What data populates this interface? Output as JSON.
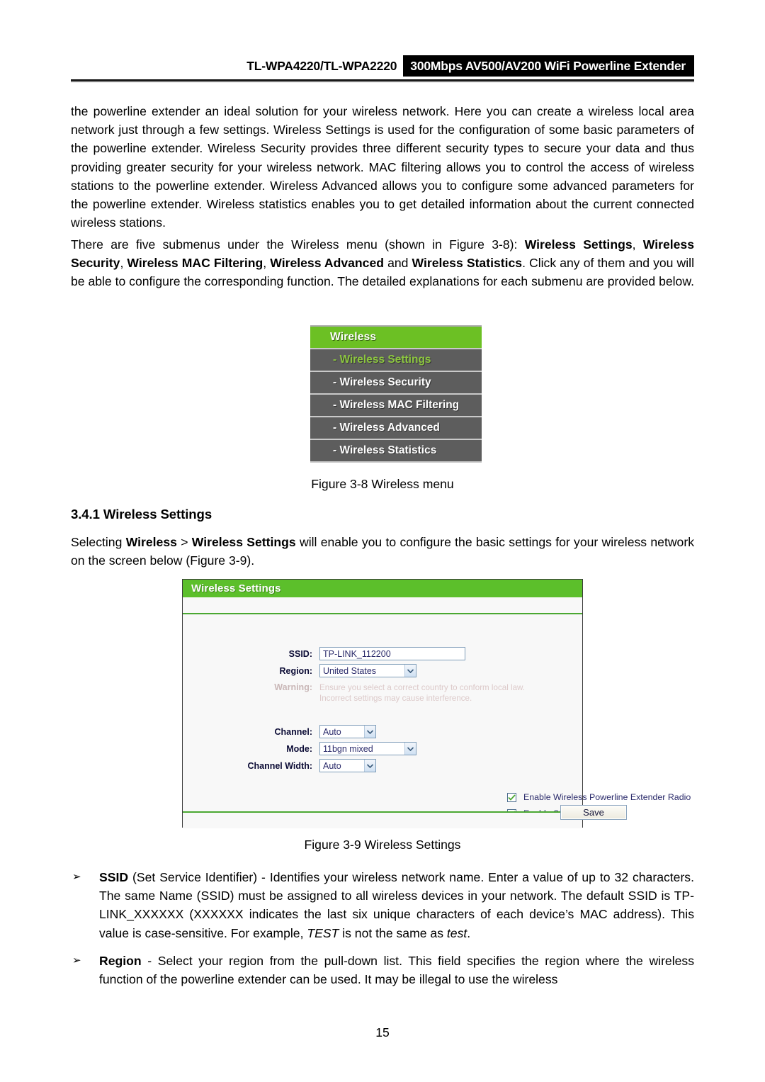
{
  "header": {
    "model": "TL-WPA4220/TL-WPA2220",
    "product": "300Mbps AV500/AV200 WiFi Powerline Extender"
  },
  "paragraphs": {
    "intro": "the powerline extender an ideal solution for your wireless network. Here you can create a wireless local area network just through a few settings. Wireless Settings is used for the configuration of some basic parameters of the powerline extender. Wireless Security provides three different security types to secure your data and thus providing greater security for your wireless network. MAC filtering allows you to control the access of wireless stations to the powerline extender. Wireless Advanced allows you to configure some advanced parameters for the powerline extender. Wireless statistics enables you to get detailed information about the current connected wireless stations.",
    "submenus_html": "There are five submenus under the Wireless menu (shown in Figure 3-8): <b>Wireless Settings</b>, <b>Wireless Security</b>, <b>Wireless MAC Filtering</b>, <b>Wireless Advanced</b> and <b>Wireless Statistics</b>. Click any of them and you will be able to configure the corresponding function. The detailed explanations for each submenu are provided below.",
    "selecting_html": "Selecting <b>Wireless</b> &gt; <b>Wireless Settings</b> will enable you to configure the basic settings for your wireless network on the screen below (Figure 3-9)."
  },
  "section_heading": "3.4.1 Wireless Settings",
  "figures": {
    "fig38_caption": "Figure 3-8 Wireless menu",
    "fig39_caption": "Figure 3-9 Wireless Settings"
  },
  "wireless_menu": {
    "header": "Wireless",
    "items": [
      {
        "label": "- Wireless Settings",
        "active": true
      },
      {
        "label": "- Wireless Security",
        "active": false
      },
      {
        "label": "- Wireless MAC Filtering",
        "active": false
      },
      {
        "label": "- Wireless Advanced",
        "active": false
      },
      {
        "label": "- Wireless Statistics",
        "active": false
      }
    ],
    "colors": {
      "header_bg": "#6cc024",
      "item_bg": "#5d5d5d",
      "active_text": "#8cc63f"
    }
  },
  "wireless_settings_panel": {
    "title": "Wireless Settings",
    "fields": {
      "ssid_label": "SSID:",
      "ssid_value": "TP-LINK_112200",
      "region_label": "Region:",
      "region_value": "United States",
      "warning_label": "Warning:",
      "warning_line1": "Ensure you select a correct country to conform local law.",
      "warning_line2": "Incorrect settings may cause interference.",
      "channel_label": "Channel:",
      "channel_value": "Auto",
      "mode_label": "Mode:",
      "mode_value": "11bgn mixed",
      "channel_width_label": "Channel Width:",
      "channel_width_value": "Auto"
    },
    "checkboxes": [
      {
        "label": "Enable Wireless Powerline Extender Radio",
        "checked": true
      },
      {
        "label": "Enable SSID Broadcast",
        "checked": true
      }
    ],
    "save_label": "Save",
    "colors": {
      "title_bg": "#5cbf2b",
      "divider": "#4aa832",
      "body_bg": "#f8f8f8",
      "check_mark": "#4aa832"
    }
  },
  "bullets": [
    {
      "mark": "➢",
      "html": "<b>SSID</b> (Set Service Identifier) - Identifies your wireless network name. Enter a value of up to 32 characters. The same Name (SSID) must be assigned to all wireless devices in your network. The default SSID is TP-LINK_XXXXXX (XXXXXX indicates the last six unique characters of each device&rsquo;s MAC address). This value is case-sensitive. For example, <i>TEST</i> is not the same as <i>test</i>."
    },
    {
      "mark": "➢",
      "html": "<b>Region</b> - Select your region from the pull-down list. This field specifies the region where the wireless function of the powerline extender can be used. It may be illegal to use the wireless"
    }
  ],
  "page_number": "15"
}
